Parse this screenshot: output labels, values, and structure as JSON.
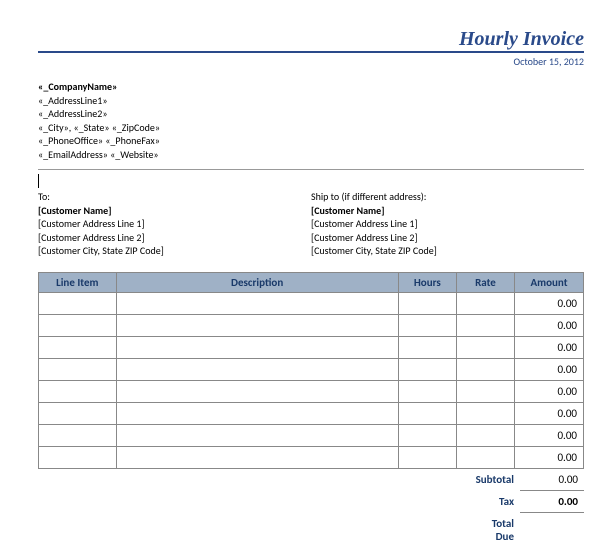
{
  "header": {
    "title": "Hourly Invoice",
    "date": "October 15, 2012"
  },
  "company": {
    "name": "«_CompanyName»",
    "addr1": "«_AddressLine1»",
    "addr2": "«_AddressLine2»",
    "citystatezip": "«_City», «_State»  «_ZipCode»",
    "phones": "«_PhoneOffice»  «_PhoneFax»",
    "emailweb": "«_EmailAddress»  «_Website»"
  },
  "billto": {
    "label": "To:",
    "name": "[Customer Name]",
    "line1": "[Customer Address Line 1]",
    "line2": "[Customer Address Line 2]",
    "city": "[Customer City, State ZIP Code]"
  },
  "shipto": {
    "label": "Ship to (if different address):",
    "name": "[Customer Name]",
    "line1": "[Customer Address Line 1]",
    "line2": "[Customer Address Line 2]",
    "city": "[Customer City, State ZIP Code]"
  },
  "table": {
    "headers": {
      "lineitem": "Line Item",
      "description": "Description",
      "hours": "Hours",
      "rate": "Rate",
      "amount": "Amount"
    },
    "rows": [
      {
        "amount": "0.00"
      },
      {
        "amount": "0.00"
      },
      {
        "amount": "0.00"
      },
      {
        "amount": "0.00"
      },
      {
        "amount": "0.00"
      },
      {
        "amount": "0.00"
      },
      {
        "amount": "0.00"
      },
      {
        "amount": "0.00"
      }
    ]
  },
  "totals": {
    "subtotal_label": "Subtotal",
    "subtotal": "0.00",
    "tax_label": "Tax",
    "tax": "0.00",
    "totaldue_label": "Total Due"
  }
}
